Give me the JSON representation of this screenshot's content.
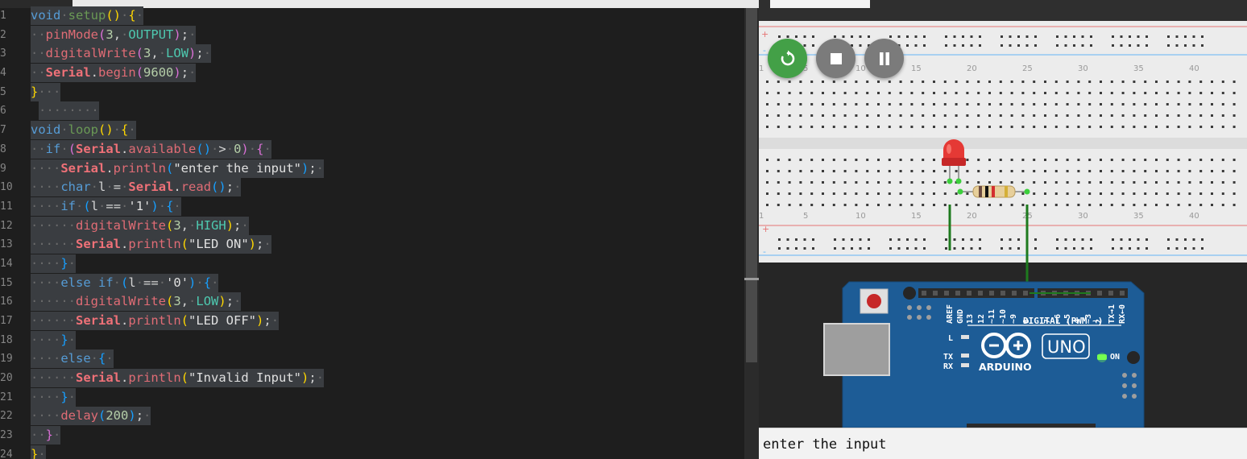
{
  "editor": {
    "line_numbers": [
      "1",
      "2",
      "3",
      "4",
      "5",
      "6",
      "7",
      "8",
      "9",
      "10",
      "11",
      "12",
      "13",
      "14",
      "15",
      "16",
      "17",
      "18",
      "19",
      "20",
      "21",
      "22",
      "23",
      "24"
    ],
    "code": {
      "l1_kw": "void",
      "l1_fn": "setup",
      "l1_paren": "()",
      "l1_brace": "{",
      "l2_fn": "pinMode",
      "l2_num": "3",
      "l2_const": "OUTPUT",
      "l3_fn": "digitalWrite",
      "l3_num": "3",
      "l3_const": "LOW",
      "l4_obj": "Serial",
      "l4_fn": "begin",
      "l4_num": "9600",
      "l5_brace": "}",
      "l7_kw": "void",
      "l7_fn": "loop",
      "l7_paren": "()",
      "l7_brace": "{",
      "l8_kw": "if",
      "l8_obj": "Serial",
      "l8_fn": "available",
      "l8_op": ">",
      "l8_num": "0",
      "l9_obj": "Serial",
      "l9_fn": "println",
      "l9_str": "\"enter the input\"",
      "l10_kw": "char",
      "l10_var": "l",
      "l10_op": "=",
      "l10_obj": "Serial",
      "l10_fn": "read",
      "l11_kw": "if",
      "l11_var": "l",
      "l11_op": "==",
      "l11_str": "'1'",
      "l12_fn": "digitalWrite",
      "l12_num": "3",
      "l12_const": "HIGH",
      "l13_obj": "Serial",
      "l13_fn": "println",
      "l13_str": "\"LED ON\"",
      "l15_kw": "else if",
      "l15_var": "l",
      "l15_op": "==",
      "l15_str": "'0'",
      "l16_fn": "digitalWrite",
      "l16_num": "3",
      "l16_const": "LOW",
      "l17_obj": "Serial",
      "l17_fn": "println",
      "l17_str": "\"LED OFF\"",
      "l19_kw": "else",
      "l20_obj": "Serial",
      "l20_fn": "println",
      "l20_str": "\"Invalid Input\"",
      "l22_fn": "delay",
      "l22_num": "200"
    }
  },
  "simulator": {
    "controls": {
      "restart_icon": "restart-icon",
      "stop_icon": "stop-icon",
      "pause_icon": "pause-icon",
      "restart_color": "#43a047",
      "control_color": "#7b7b7b"
    },
    "breadboard": {
      "column_labels": [
        "1",
        "5",
        "10",
        "15",
        "20",
        "25",
        "30",
        "35",
        "40"
      ],
      "rail_plus": "+",
      "rail_minus": "-"
    },
    "arduino": {
      "header_labels": [
        "AREF",
        "GND",
        "13",
        "12",
        "~11",
        "~10",
        "~9",
        "8",
        "7",
        "~6",
        "~5",
        "4",
        "~3",
        "2",
        "TX→1",
        "RX←0"
      ],
      "digital_label": "DIGITAL (PWM ~)",
      "l_label": "L",
      "tx_label": "TX",
      "rx_label": "RX",
      "brand": "ARDUINO",
      "model": "UNO",
      "on_label": "ON",
      "board_color": "#1d5c96",
      "on_led_color": "#76ff50"
    },
    "led_color": "#e53935",
    "wire_color": "#1e7a1e"
  },
  "serial_monitor": {
    "output": "enter the input"
  }
}
